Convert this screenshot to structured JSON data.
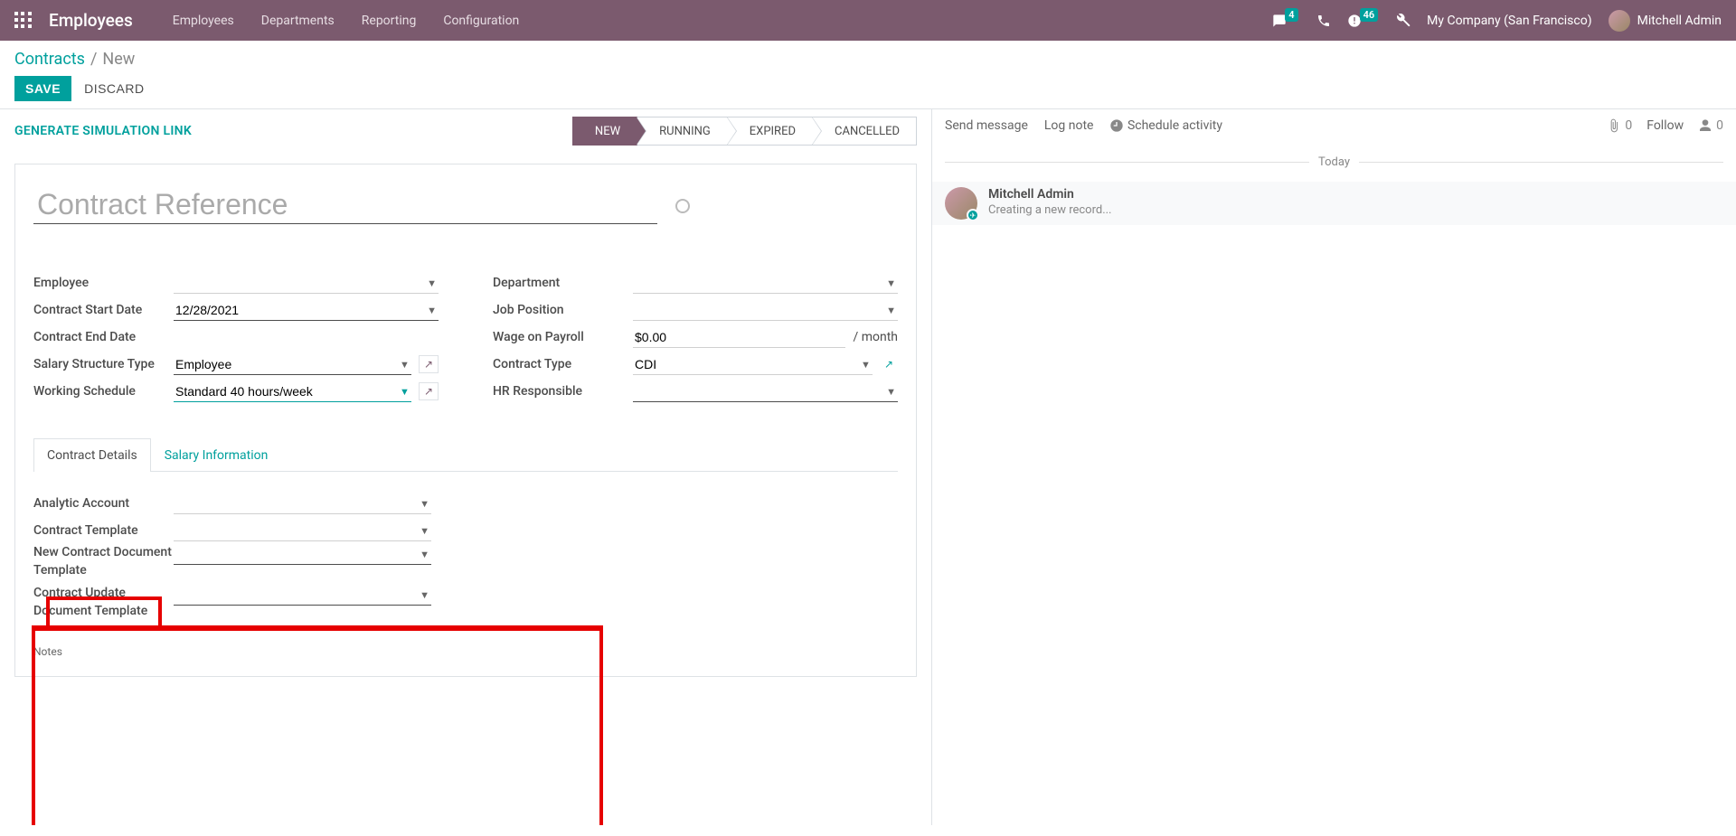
{
  "navbar": {
    "app_title": "Employees",
    "links": [
      "Employees",
      "Departments",
      "Reporting",
      "Configuration"
    ],
    "messages_badge": "4",
    "activities_badge": "46",
    "company": "My Company (San Francisco)",
    "user": "Mitchell Admin"
  },
  "breadcrumb": {
    "parent": "Contracts",
    "current": "New"
  },
  "buttons": {
    "save": "SAVE",
    "discard": "DISCARD",
    "generate": "GENERATE SIMULATION LINK"
  },
  "status": {
    "new": "NEW",
    "running": "RUNNING",
    "expired": "EXPIRED",
    "cancelled": "CANCELLED"
  },
  "form": {
    "title_placeholder": "Contract Reference",
    "left_labels": {
      "employee": "Employee",
      "start": "Contract Start Date",
      "end": "Contract End Date",
      "sst": "Salary Structure Type",
      "ws": "Working Schedule"
    },
    "left_values": {
      "start": "12/28/2021",
      "sst": "Employee",
      "ws": "Standard 40 hours/week"
    },
    "right_labels": {
      "dept": "Department",
      "job": "Job Position",
      "wage": "Wage on Payroll",
      "ctype": "Contract Type",
      "hr": "HR Responsible"
    },
    "right_values": {
      "wage": "$0.00",
      "wage_unit": "/ month",
      "ctype": "CDI"
    }
  },
  "tabs": {
    "t1": "Contract Details",
    "t2": "Salary Information"
  },
  "details": {
    "analytic": "Analytic Account",
    "tmpl": "Contract Template",
    "new_doc": "New Contract Document Template",
    "upd_doc": "Contract Update Document Template",
    "notes": "Notes"
  },
  "chatter": {
    "send": "Send message",
    "log": "Log note",
    "schedule": "Schedule activity",
    "attach_count": "0",
    "follow": "Follow",
    "follower_count": "0",
    "date": "Today",
    "author": "Mitchell Admin",
    "text": "Creating a new record..."
  }
}
